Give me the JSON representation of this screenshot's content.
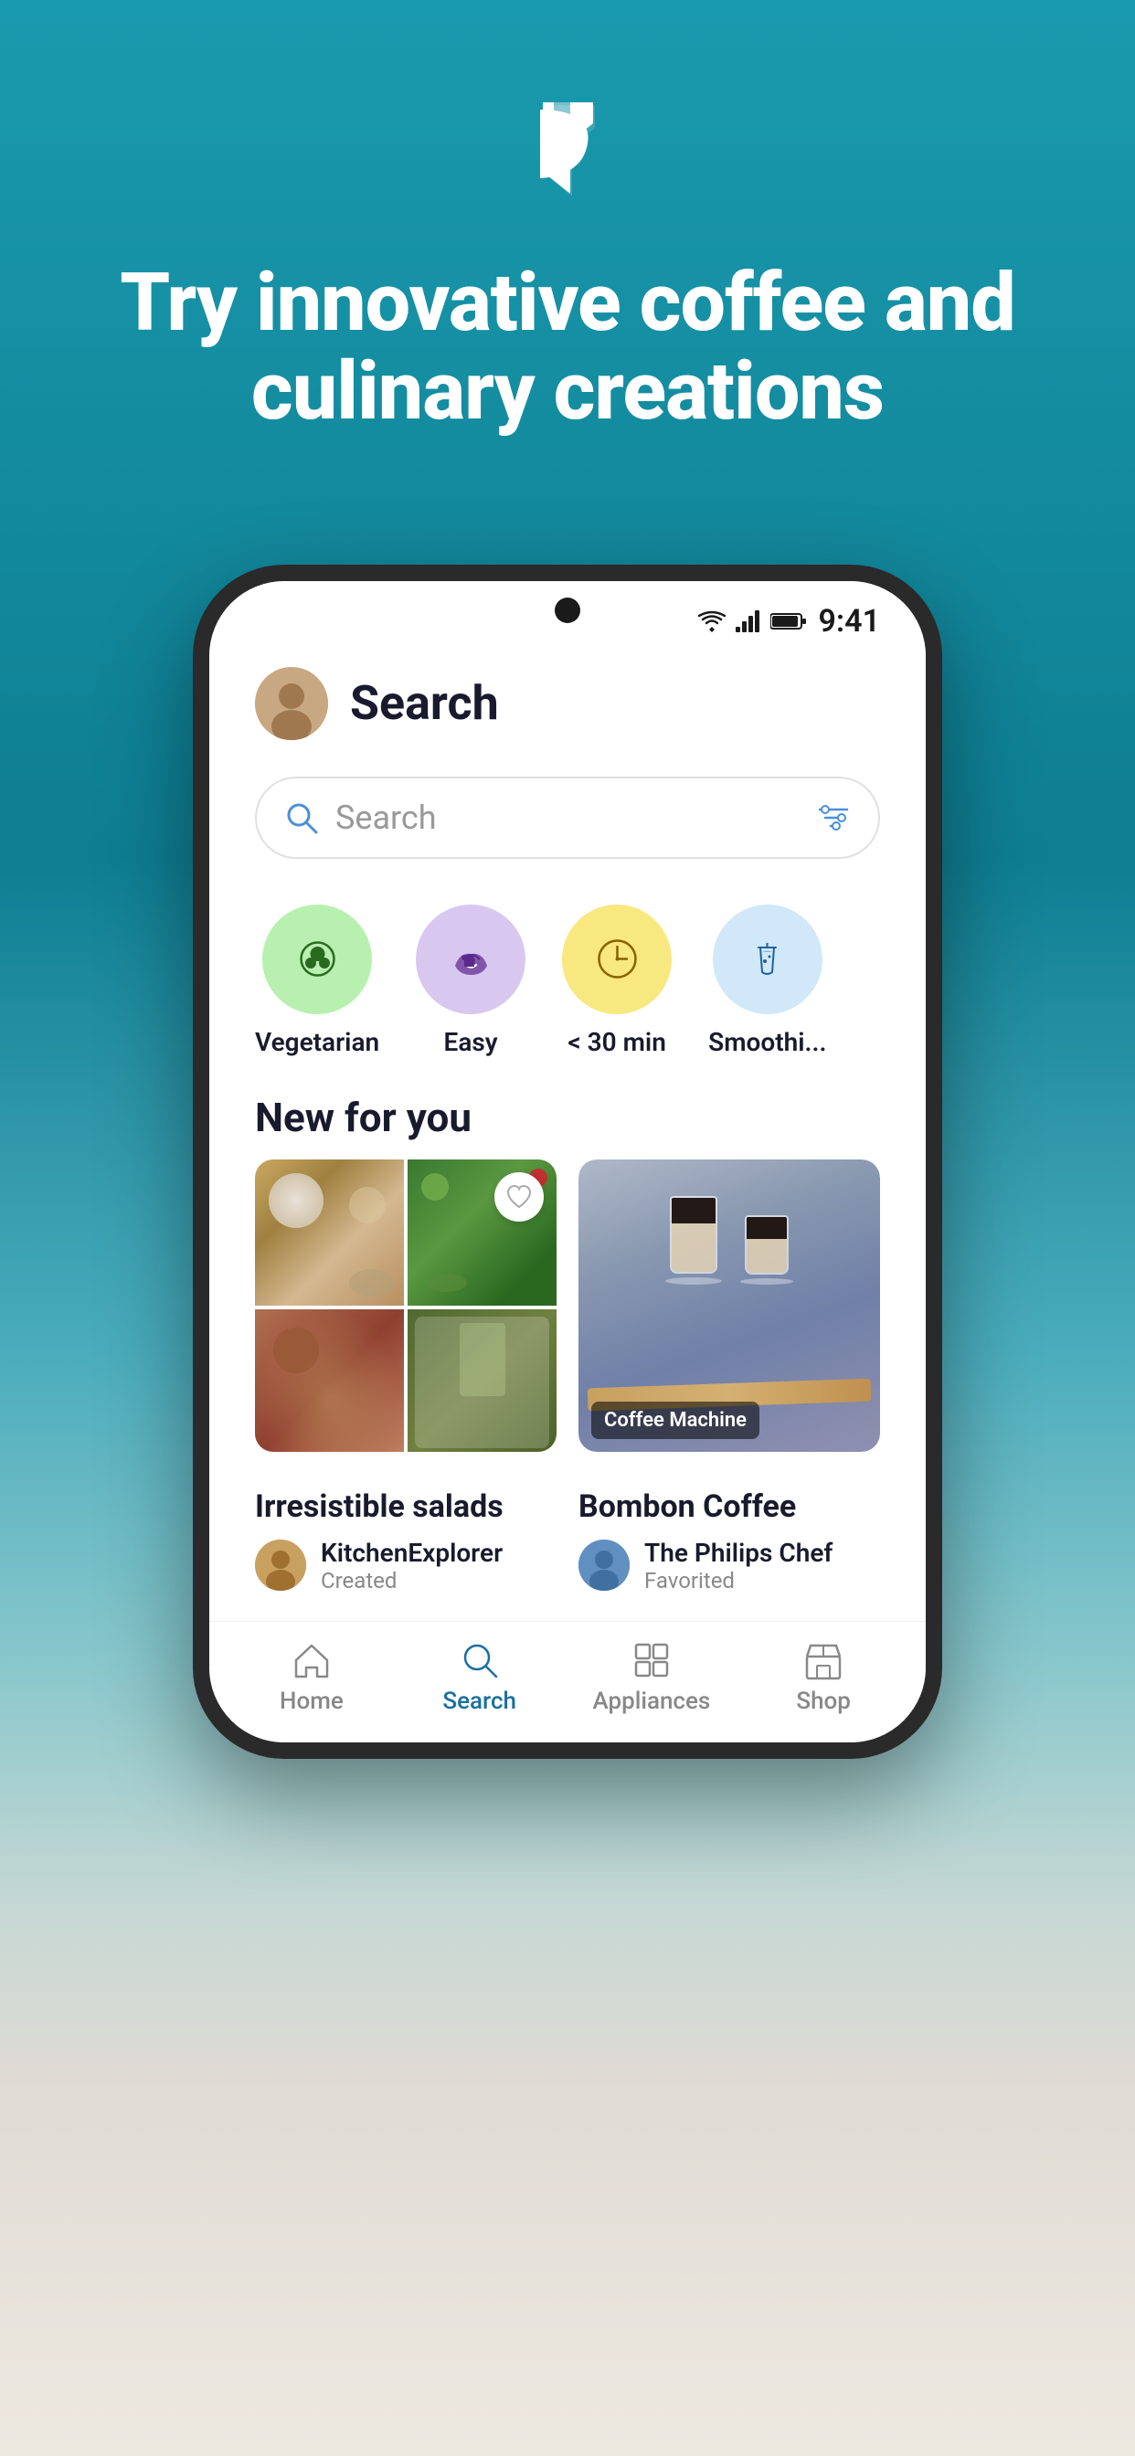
{
  "app": {
    "background_gradient_top": "#1a8fa0",
    "background_gradient_bottom": "#0d7a8a"
  },
  "hero": {
    "title": "Try innovative coffee and culinary creations",
    "logo_alt": "App logo"
  },
  "status_bar": {
    "time": "9:41",
    "wifi": "▲",
    "signal": "◀",
    "battery": "▐"
  },
  "header": {
    "title": "Search",
    "avatar_alt": "User avatar"
  },
  "search": {
    "placeholder": "Search",
    "search_icon": "🔍",
    "filter_icon": "⚙"
  },
  "categories": [
    {
      "id": "vegetarian",
      "label": "Vegetarian",
      "emoji": "🥦",
      "color": "green"
    },
    {
      "id": "easy",
      "label": "Easy",
      "emoji": "👍",
      "color": "purple"
    },
    {
      "id": "quick",
      "label": "< 30 min",
      "emoji": "🕐",
      "color": "yellow"
    },
    {
      "id": "smoothie",
      "label": "Smoothi...",
      "emoji": "🥤",
      "color": "blue"
    }
  ],
  "new_for_you": {
    "section_title": "New for you",
    "cards": [
      {
        "id": "irresistible-salads",
        "title": "Irresistible salads",
        "author": "KitchenExplorer",
        "action": "Created",
        "label": null,
        "has_heart": true
      },
      {
        "id": "bombon-coffee",
        "title": "Bombon Coffee",
        "author": "The Philips Chef",
        "action": "Favorited",
        "label": "Coffee Machine",
        "has_heart": false
      }
    ]
  },
  "bottom_nav": {
    "items": [
      {
        "id": "home",
        "label": "Home",
        "icon": "🏠",
        "active": false
      },
      {
        "id": "search",
        "label": "Search",
        "icon": "🔍",
        "active": true
      },
      {
        "id": "appliances",
        "label": "Appliances",
        "icon": "⊞",
        "active": false
      },
      {
        "id": "shop",
        "label": "Shop",
        "icon": "🏪",
        "active": false
      }
    ]
  }
}
